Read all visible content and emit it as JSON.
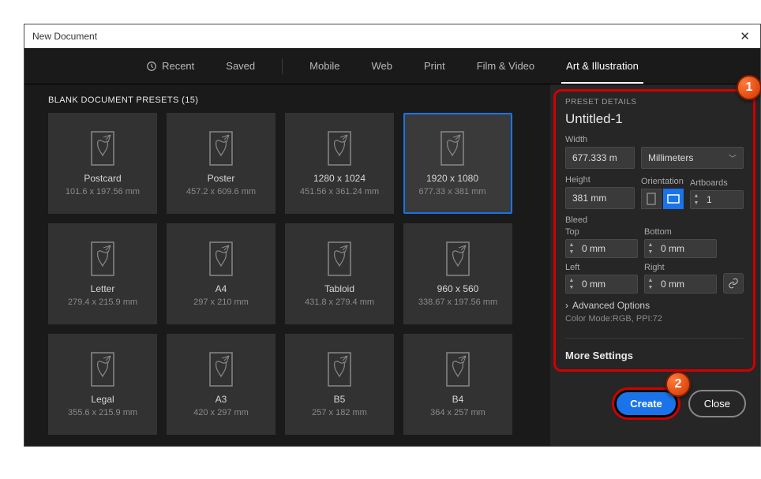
{
  "window": {
    "title": "New Document"
  },
  "tabs": {
    "recent": "Recent",
    "saved": "Saved",
    "mobile": "Mobile",
    "web": "Web",
    "print": "Print",
    "film": "Film & Video",
    "art": "Art & Illustration"
  },
  "presets": {
    "heading": "BLANK DOCUMENT PRESETS  (15)",
    "items": [
      {
        "name": "Postcard",
        "size": "101.6 x 197.56 mm"
      },
      {
        "name": "Poster",
        "size": "457.2 x 609.6 mm"
      },
      {
        "name": "1280 x 1024",
        "size": "451.56 x 361.24 mm"
      },
      {
        "name": "1920 x 1080",
        "size": "677.33 x 381 mm"
      },
      {
        "name": "Letter",
        "size": "279.4 x 215.9 mm"
      },
      {
        "name": "A4",
        "size": "297 x 210 mm"
      },
      {
        "name": "Tabloid",
        "size": "431.8 x 279.4 mm"
      },
      {
        "name": "960 x 560",
        "size": "338.67 x 197.56 mm"
      },
      {
        "name": "Legal",
        "size": "355.6 x 215.9 mm"
      },
      {
        "name": "A3",
        "size": "420 x 297 mm"
      },
      {
        "name": "B5",
        "size": "257 x 182 mm"
      },
      {
        "name": "B4",
        "size": "364 x 257 mm"
      }
    ]
  },
  "details": {
    "heading": "PRESET DETAILS",
    "name": "Untitled-1",
    "width_label": "Width",
    "width": "677.333 m",
    "units": "Millimeters",
    "height_label": "Height",
    "height": "381 mm",
    "orientation_label": "Orientation",
    "artboards_label": "Artboards",
    "artboards": "1",
    "bleed_label": "Bleed",
    "top_label": "Top",
    "top": "0 mm",
    "bottom_label": "Bottom",
    "bottom": "0 mm",
    "left_label": "Left",
    "left": "0 mm",
    "right_label": "Right",
    "right": "0 mm",
    "advanced": "Advanced Options",
    "colormode": "Color Mode:RGB, PPI:72",
    "more": "More Settings"
  },
  "footer": {
    "create": "Create",
    "close": "Close"
  },
  "badges": {
    "one": "1",
    "two": "2"
  }
}
